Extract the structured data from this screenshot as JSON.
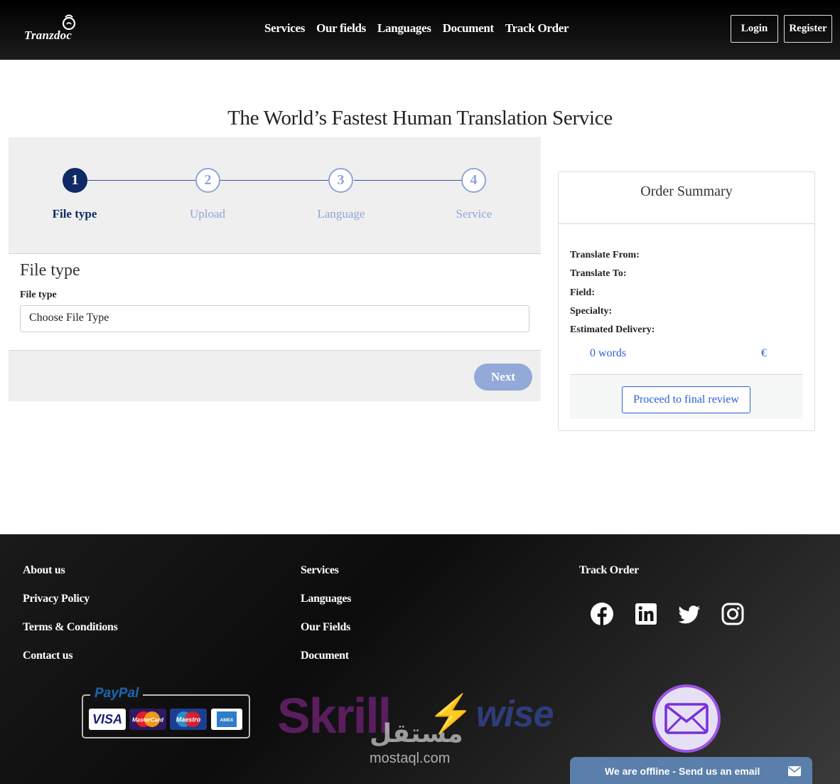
{
  "header": {
    "logo_text": "Tranzdoc",
    "nav": [
      "Services",
      "Our fields",
      "Languages",
      "Document",
      "Track Order"
    ],
    "login_label": "Login",
    "register_label": "Register"
  },
  "page_title": "The World’s Fastest Human Translation Service",
  "wizard": {
    "steps": [
      {
        "number": "1",
        "label": "File type",
        "state": "active"
      },
      {
        "number": "2",
        "label": "Upload",
        "state": "pending"
      },
      {
        "number": "3",
        "label": "Language",
        "state": "pending"
      },
      {
        "number": "4",
        "label": "Service",
        "state": "pending"
      }
    ],
    "section_title": "File type",
    "field_label": "File type",
    "select_value": "Choose File Type",
    "next_label": "Next"
  },
  "summary": {
    "title": "Order Summary",
    "rows": [
      "Translate From:",
      "Translate To:",
      "Field:",
      "Specialty:",
      "Estimated Delivery:"
    ],
    "words": "0 words",
    "currency": "€",
    "proceed_label": "Proceed to final review"
  },
  "footer": {
    "col1": [
      "About us",
      "Privacy Policy",
      "Terms & Conditions",
      "Contact us"
    ],
    "col2": [
      "Services",
      "Languages",
      "Our Fields",
      "Document"
    ],
    "col3_title": "Track Order",
    "social": [
      "facebook-icon",
      "linkedin-icon",
      "twitter-icon",
      "instagram-icon"
    ],
    "payment": {
      "paypal": "PayPal",
      "cards": [
        "VISA",
        "MasterCard",
        "Maestro",
        "AMEX"
      ],
      "skrill": "Skrill",
      "wise": "wise"
    },
    "watermark_ar": "مستقل",
    "watermark_en": "mostaql.com",
    "offline_text": "We are offline - Send us an email"
  },
  "colors": {
    "accent": "#0f2a66",
    "pending": "#8fa6d6",
    "link": "#2b5fd9",
    "next_button": "#93a9d8",
    "offline_bar": "#5b7fab"
  }
}
